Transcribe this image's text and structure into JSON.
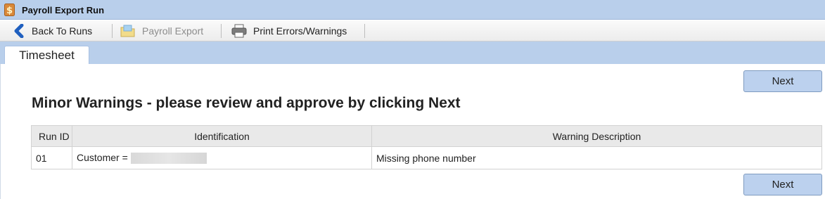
{
  "window": {
    "title": "Payroll Export Run"
  },
  "toolbar": {
    "back_label": "Back To Runs",
    "export_label": "Payroll Export",
    "print_label": "Print Errors/Warnings"
  },
  "tabs": [
    {
      "label": "Timesheet"
    }
  ],
  "main": {
    "heading": "Minor Warnings - please review and approve by clicking Next",
    "next_label": "Next",
    "table": {
      "headers": [
        "Run ID",
        "Identification",
        "Warning Description"
      ],
      "rows": [
        {
          "run_id": "01",
          "identification": "Customer =",
          "warning": "Missing phone number"
        }
      ]
    }
  },
  "colors": {
    "accent": "#b9cfeb",
    "button": "#bcd1ee"
  }
}
